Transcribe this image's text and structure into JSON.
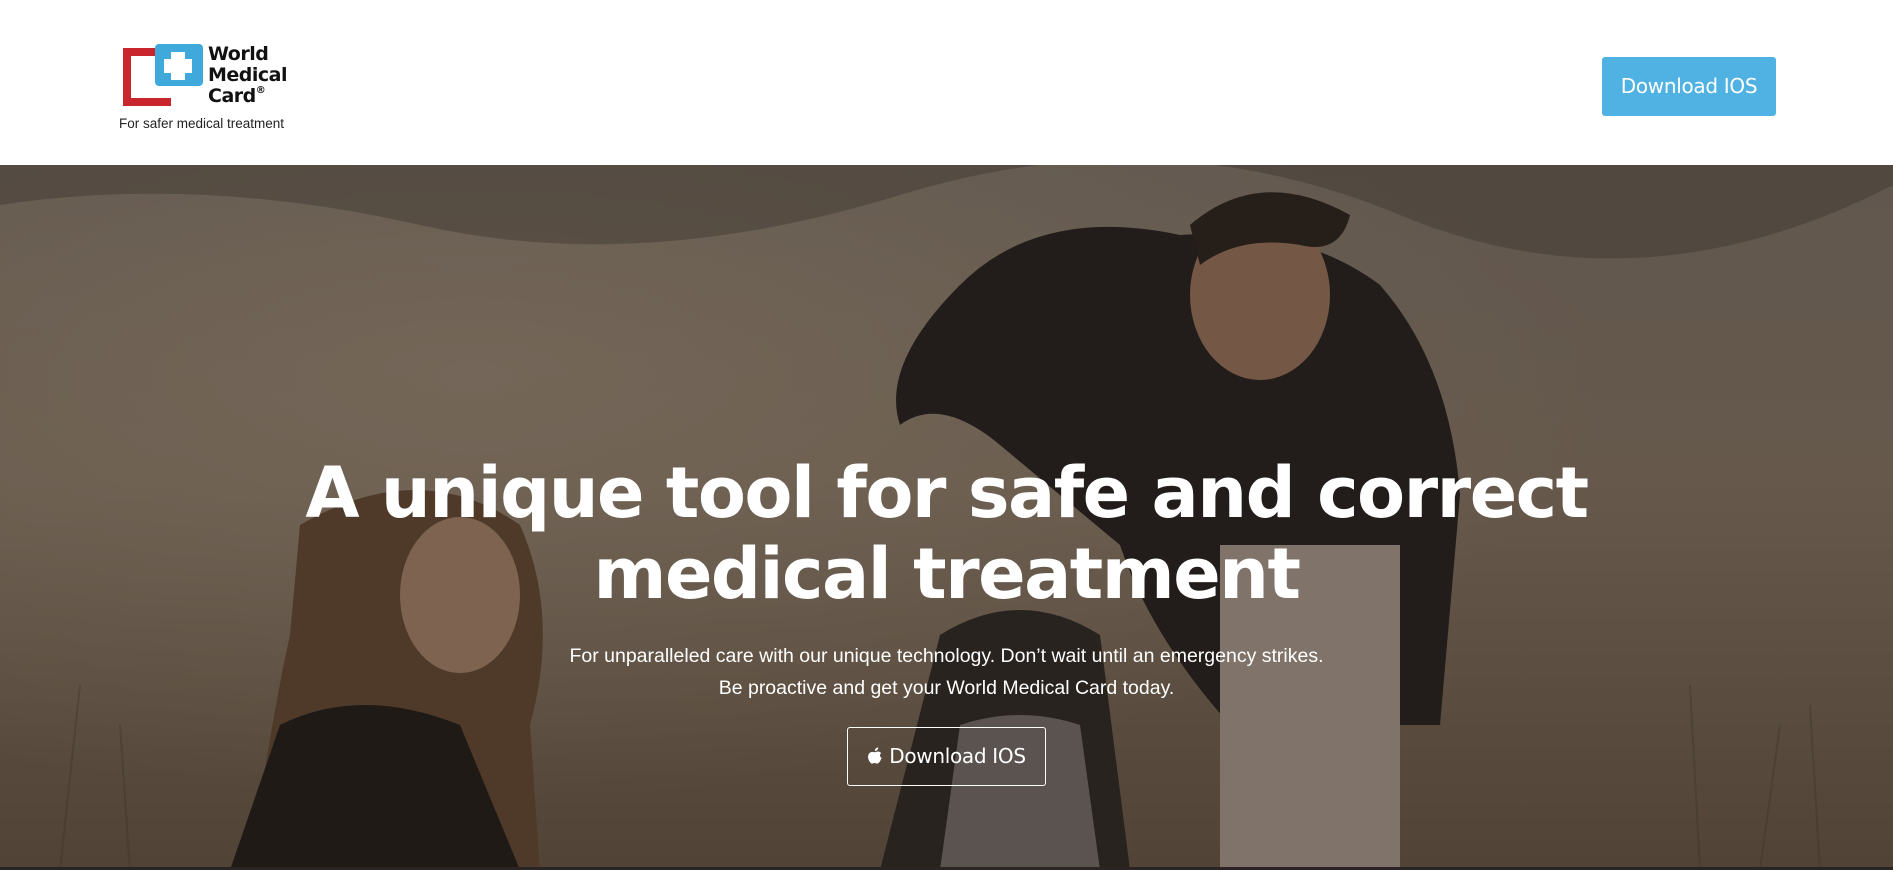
{
  "header": {
    "logo": {
      "name_lines": [
        "World",
        "Medical",
        "Card"
      ],
      "registered_mark": "®",
      "tagline": "For safer medical treatment"
    },
    "download_button": "Download IOS"
  },
  "hero": {
    "title_line1": "A unique tool for safe and correct",
    "title_line2": "medical treatment",
    "subtitle_line1": "For unparalleled care with our unique technology. Don’t wait until an emergency strikes.",
    "subtitle_line2": "Be proactive and get your World Medical Card today.",
    "download_button": "Download IOS",
    "button_icon": "apple-icon"
  },
  "colors": {
    "accent": "#4fb2e2",
    "logo_red": "#c9252c",
    "logo_blue": "#3fa9dc",
    "text_on_hero": "#ffffff"
  }
}
